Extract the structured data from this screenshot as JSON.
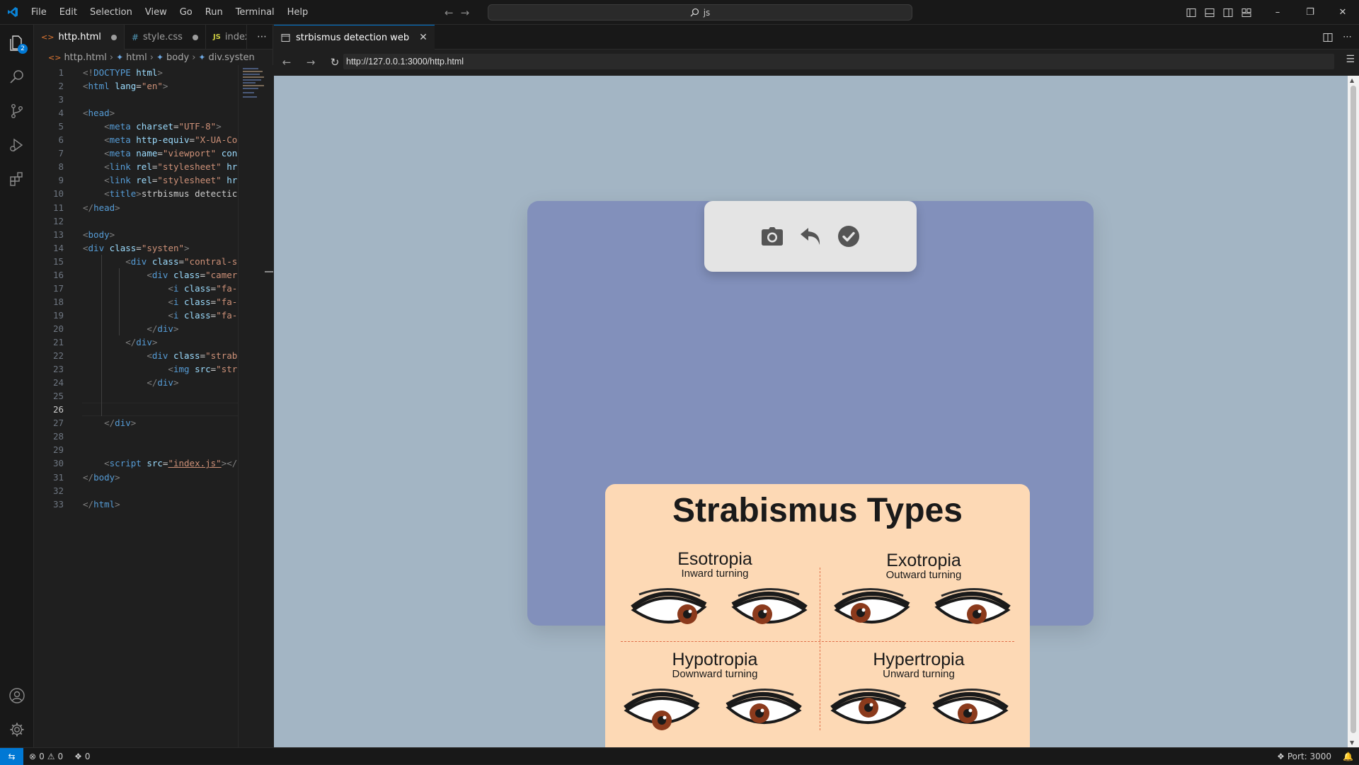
{
  "titlebar": {
    "menu": [
      "File",
      "Edit",
      "Selection",
      "View",
      "Go",
      "Run",
      "Terminal",
      "Help"
    ],
    "search_text": "js"
  },
  "activitybar": {
    "explorer_badge": "2"
  },
  "editor": {
    "tabs": [
      {
        "label": "http.html",
        "icon": "html-file-icon",
        "modified": true
      },
      {
        "label": "style.css",
        "icon": "css-file-icon",
        "modified": true
      },
      {
        "label": "index",
        "icon": "js-file-icon",
        "modified": false
      }
    ],
    "breadcrumb": [
      "http.html",
      "html",
      "body",
      "div.systen"
    ],
    "current_line": 26,
    "lines": [
      {
        "n": 1,
        "html": "<span class='t'>&lt;!</span><span class='tag'>DOCTYPE</span> <span class='at'>html</span><span class='t'>&gt;</span>"
      },
      {
        "n": 2,
        "html": "<span class='t'>&lt;</span><span class='tag'>html</span> <span class='at'>lang</span><span class='tx'>=</span><span class='st'>\"en\"</span><span class='t'>&gt;</span>"
      },
      {
        "n": 3,
        "html": ""
      },
      {
        "n": 4,
        "html": "<span class='t'>&lt;</span><span class='tag'>head</span><span class='t'>&gt;</span>"
      },
      {
        "n": 5,
        "html": "    <span class='t'>&lt;</span><span class='tag'>meta</span> <span class='at'>charset</span><span class='tx'>=</span><span class='st'>\"UTF-8\"</span><span class='t'>&gt;</span>"
      },
      {
        "n": 6,
        "html": "    <span class='t'>&lt;</span><span class='tag'>meta</span> <span class='at'>http-equiv</span><span class='tx'>=</span><span class='st'>\"X-UA-Co</span>"
      },
      {
        "n": 7,
        "html": "    <span class='t'>&lt;</span><span class='tag'>meta</span> <span class='at'>name</span><span class='tx'>=</span><span class='st'>\"viewport\"</span> <span class='at'>con</span>"
      },
      {
        "n": 8,
        "html": "    <span class='t'>&lt;</span><span class='tag'>link</span> <span class='at'>rel</span><span class='tx'>=</span><span class='st'>\"stylesheet\"</span> <span class='at'>hr</span>"
      },
      {
        "n": 9,
        "html": "    <span class='t'>&lt;</span><span class='tag'>link</span> <span class='at'>rel</span><span class='tx'>=</span><span class='st'>\"stylesheet\"</span> <span class='at'>hr</span>"
      },
      {
        "n": 10,
        "html": "    <span class='t'>&lt;</span><span class='tag'>title</span><span class='t'>&gt;</span><span class='tx'>strbismus detectic</span>"
      },
      {
        "n": 11,
        "html": "<span class='t'>&lt;/</span><span class='tag'>head</span><span class='t'>&gt;</span>"
      },
      {
        "n": 12,
        "html": ""
      },
      {
        "n": 13,
        "html": "<span class='t'>&lt;</span><span class='tag'>body</span><span class='t'>&gt;</span>"
      },
      {
        "n": 14,
        "html": "<span class='t'>&lt;</span><span class='tag'>div</span> <span class='at'>class</span><span class='tx'>=</span><span class='st'>\"systen\"</span><span class='t'>&gt;</span>"
      },
      {
        "n": 15,
        "html": "        <span class='t'>&lt;</span><span class='tag'>div</span> <span class='at'>class</span><span class='tx'>=</span><span class='st'>\"contral-s</span>"
      },
      {
        "n": 16,
        "html": "            <span class='t'>&lt;</span><span class='tag'>div</span> <span class='at'>class</span><span class='tx'>=</span><span class='st'>\"camer</span>"
      },
      {
        "n": 17,
        "html": "                <span class='t'>&lt;</span><span class='tag'>i</span> <span class='at'>class</span><span class='tx'>=</span><span class='st'>\"fa-</span>"
      },
      {
        "n": 18,
        "html": "                <span class='t'>&lt;</span><span class='tag'>i</span> <span class='at'>class</span><span class='tx'>=</span><span class='st'>\"fa-</span>"
      },
      {
        "n": 19,
        "html": "                <span class='t'>&lt;</span><span class='tag'>i</span> <span class='at'>class</span><span class='tx'>=</span><span class='st'>\"fa-</span>"
      },
      {
        "n": 20,
        "html": "            <span class='t'>&lt;/</span><span class='tag'>div</span><span class='t'>&gt;</span>"
      },
      {
        "n": 21,
        "html": "        <span class='t'>&lt;/</span><span class='tag'>div</span><span class='t'>&gt;</span>"
      },
      {
        "n": 22,
        "html": "            <span class='t'>&lt;</span><span class='tag'>div</span> <span class='at'>class</span><span class='tx'>=</span><span class='st'>\"strab</span>"
      },
      {
        "n": 23,
        "html": "                <span class='t'>&lt;</span><span class='tag'>img</span> <span class='at'>src</span><span class='tx'>=</span><span class='st'>\"str</span>"
      },
      {
        "n": 24,
        "html": "            <span class='t'>&lt;/</span><span class='tag'>div</span><span class='t'>&gt;</span>"
      },
      {
        "n": 25,
        "html": ""
      },
      {
        "n": 26,
        "html": ""
      },
      {
        "n": 27,
        "html": "    <span class='t'>&lt;/</span><span class='tag'>div</span><span class='t'>&gt;</span>"
      },
      {
        "n": 28,
        "html": ""
      },
      {
        "n": 29,
        "html": ""
      },
      {
        "n": 30,
        "html": "    <span class='t'>&lt;</span><span class='tag'>script</span> <span class='at'>src</span><span class='tx'>=</span><span class='st' style='text-decoration:underline'>\"index.js\"</span><span class='t'>&gt;&lt;/</span>"
      },
      {
        "n": 31,
        "html": "<span class='t'>&lt;/</span><span class='tag'>body</span><span class='t'>&gt;</span>"
      },
      {
        "n": 32,
        "html": ""
      },
      {
        "n": 33,
        "html": "<span class='t'>&lt;/</span><span class='tag'>html</span><span class='t'>&gt;</span>"
      }
    ]
  },
  "preview": {
    "tab_title": "strbismus detection web",
    "url": "http://127.0.0.1:3000/http.html",
    "control_buttons": [
      "camera-icon",
      "undo-icon",
      "check-circle-icon"
    ],
    "strabismus": {
      "title": "Strabismus Types",
      "types": [
        {
          "name": "Esotropia",
          "desc": "Inward turning"
        },
        {
          "name": "Exotropia",
          "desc": "Outward turning"
        },
        {
          "name": "Hypotropia",
          "desc": "Downward turning"
        },
        {
          "name": "Hypertropia",
          "desc": "Unward turning"
        }
      ]
    }
  },
  "statusbar": {
    "errors": "0",
    "warnings": "0",
    "ports": "0",
    "port_label": "Port: 3000"
  },
  "colors": {
    "accent": "#0078d4",
    "page_bg": "#a3b5c4",
    "system_bg": "#8290bb",
    "card_bg": "#fdd9b5"
  }
}
